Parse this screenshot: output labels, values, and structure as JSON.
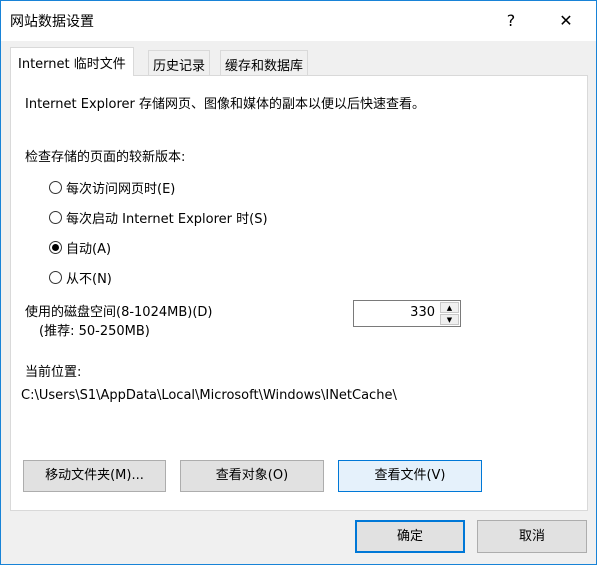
{
  "window": {
    "title": "网站数据设置",
    "help_icon": "?",
    "close_icon": "✕"
  },
  "tabs": [
    {
      "label": "Internet 临时文件"
    },
    {
      "label": "历史记录"
    },
    {
      "label": "缓存和数据库"
    }
  ],
  "temp_files": {
    "description": "Internet Explorer 存储网页、图像和媒体的副本以便以后快速查看。",
    "check_label": "检查存储的页面的较新版本:",
    "options": [
      {
        "label": "每次访问网页时(E)",
        "selected": false
      },
      {
        "label": "每次启动 Internet Explorer 时(S)",
        "selected": false
      },
      {
        "label": "自动(A)",
        "selected": true
      },
      {
        "label": "从不(N)",
        "selected": false
      }
    ],
    "disk_label": "使用的磁盘空间(8-1024MB)(D)",
    "disk_hint": "(推荐: 50-250MB)",
    "disk_value": "330",
    "location_label": "当前位置:",
    "location_path": "C:\\Users\\S1\\AppData\\Local\\Microsoft\\Windows\\INetCache\\",
    "move_button": "移动文件夹(M)...",
    "view_objects_button": "查看对象(O)",
    "view_files_button": "查看文件(V)"
  },
  "footer": {
    "ok": "确定",
    "cancel": "取消"
  }
}
